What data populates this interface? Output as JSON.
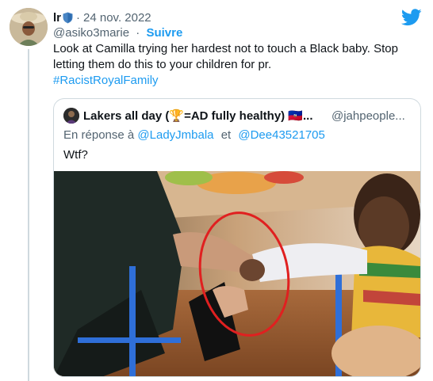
{
  "tweet": {
    "author_name": "lr",
    "date": "24 nov. 2022",
    "handle": "@asiko3marie",
    "separator": "·",
    "follow_label": "Suivre",
    "text": "Look at Camilla trying her hardest not to touch a Black baby. Stop letting them do this to your children for pr.",
    "hashtag": "#RacistRoyalFamily",
    "colors": {
      "link": "#1d9bf0",
      "muted": "#536471",
      "text": "#0f1419",
      "border": "#cfd9de"
    }
  },
  "quoted_tweet": {
    "author_name": "Lakers all day (🏆=AD fully healthy) 🇭🇹...",
    "handle": "@jahpeople...",
    "reply_prefix": "En réponse à",
    "reply_to_1": "@LadyJmbala",
    "reply_conjunction": "et",
    "reply_to_2": "@Dee43521705",
    "text": "Wtf?"
  },
  "icons": {
    "brand": "twitter-bird-icon",
    "badge": "shield-icon"
  }
}
